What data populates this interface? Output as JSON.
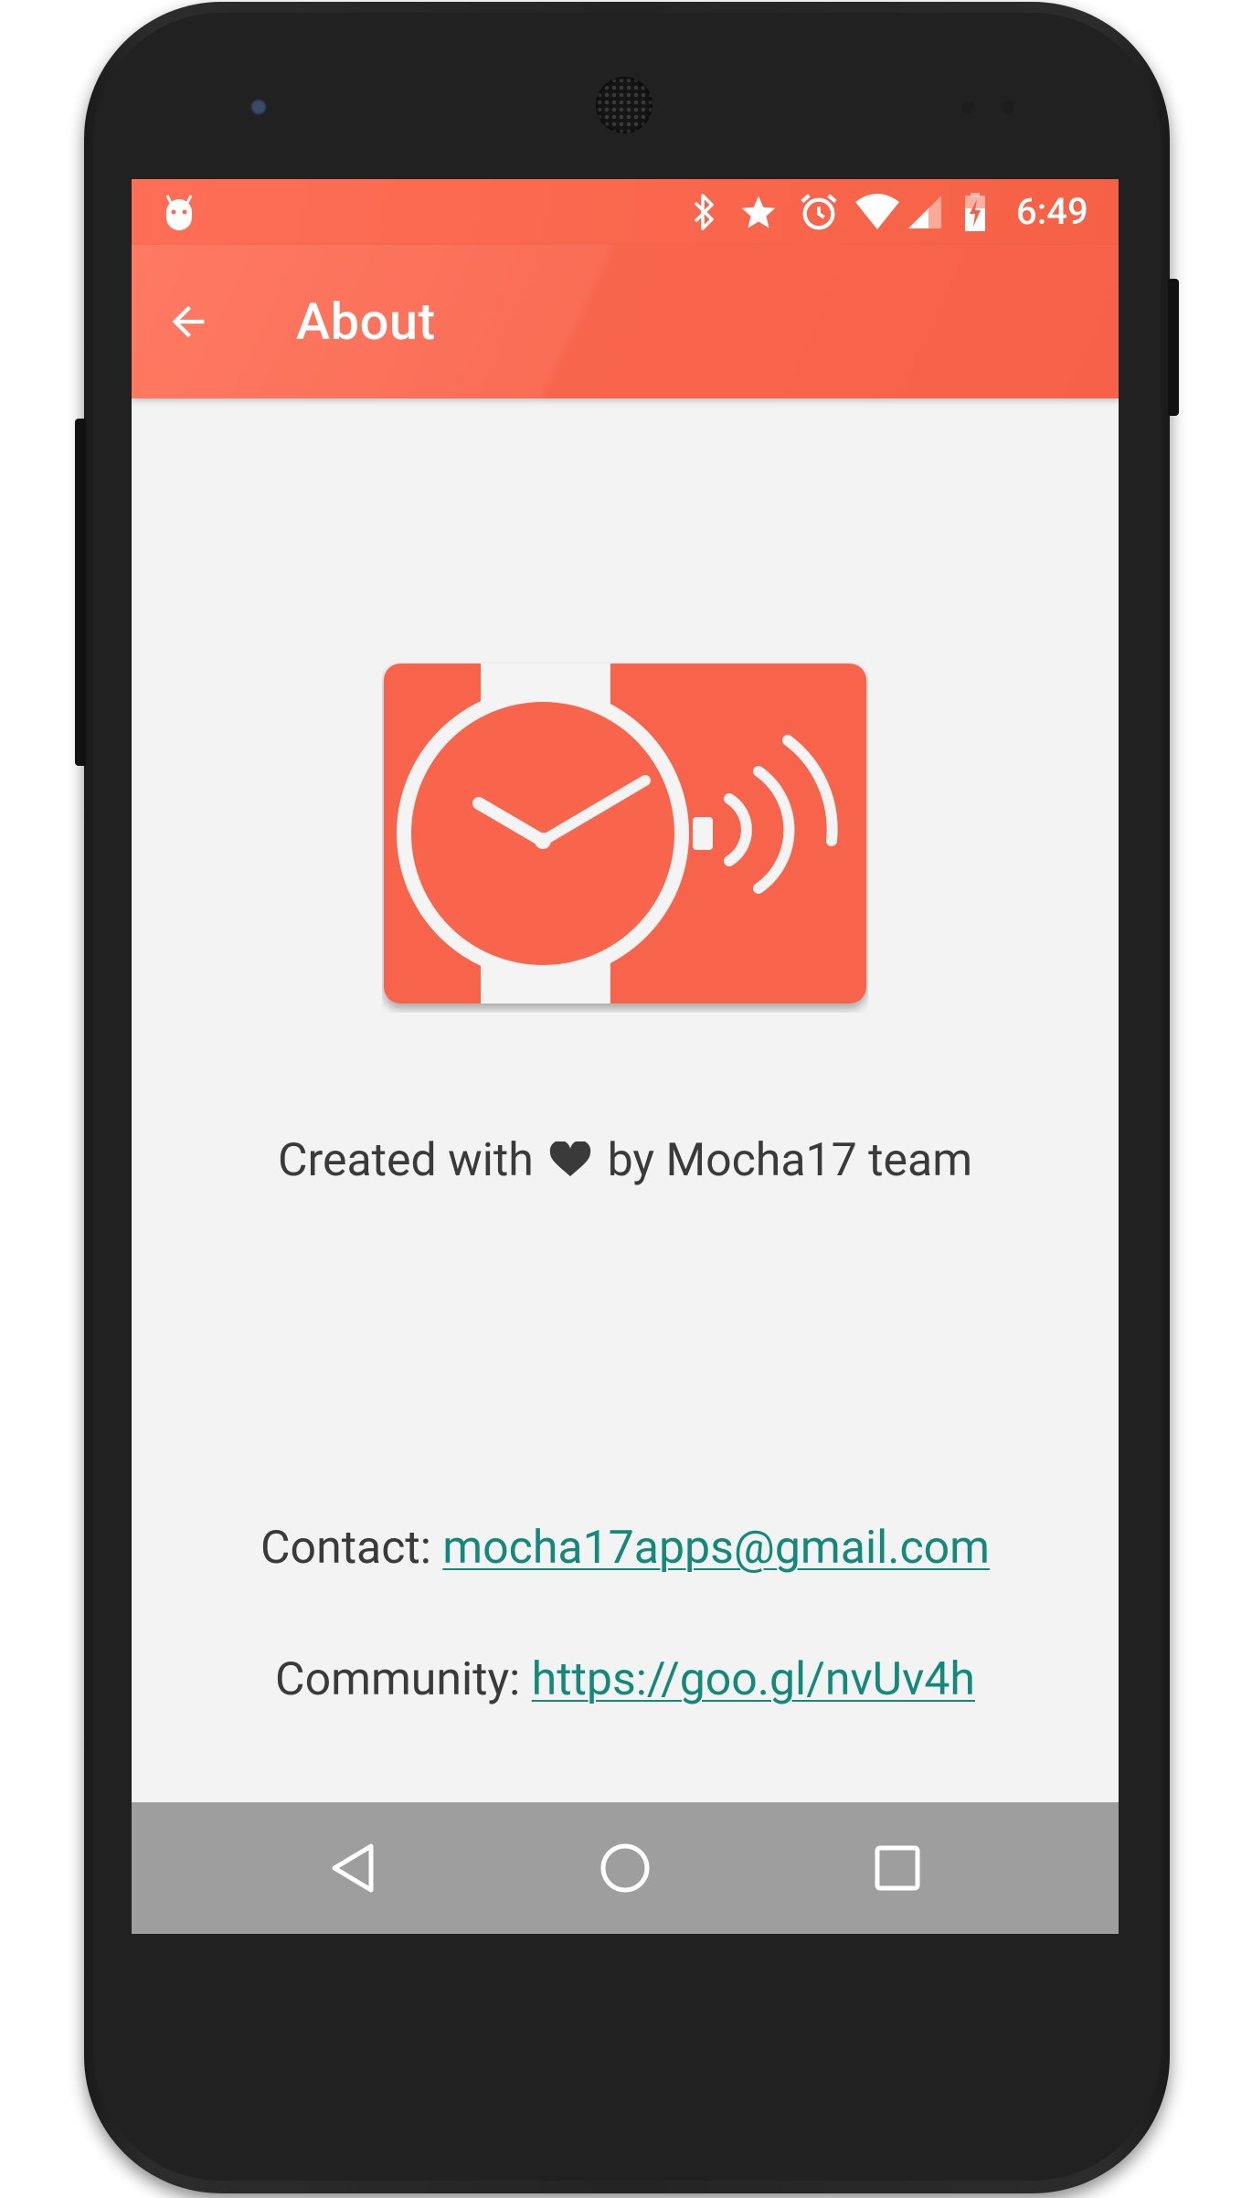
{
  "status_bar": {
    "time": "6:49",
    "icons": [
      "android-debug-icon",
      "bluetooth-icon",
      "star-icon",
      "alarm-icon",
      "wifi-icon",
      "cell-signal-icon",
      "battery-charging-icon"
    ]
  },
  "toolbar": {
    "title": "About",
    "back_icon": "arrow-back-icon"
  },
  "content": {
    "logo_icon": "watch-notification-logo-icon",
    "created_prefix": "Created with",
    "created_suffix": "by Mocha17 team",
    "contact_label": "Contact:",
    "contact_email": "mocha17apps@gmail.com",
    "community_label": "Community:",
    "community_url": "https://goo.gl/nvUv4h"
  },
  "nav_bar": {
    "buttons": [
      "back-triangle-icon",
      "home-circle-icon",
      "recents-square-icon"
    ]
  },
  "colors": {
    "accent": "#fa6a51",
    "link": "#13897a",
    "nav_bar": "#9e9e9e",
    "background": "#f3f3f3"
  }
}
